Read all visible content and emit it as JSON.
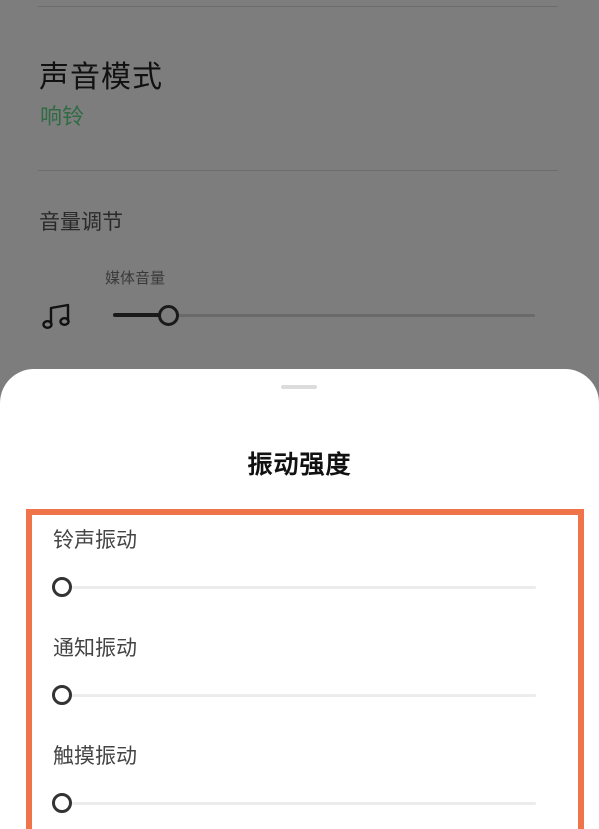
{
  "background": {
    "sound_mode": {
      "title": "声音模式",
      "value": "响铃"
    },
    "volume": {
      "section_title": "音量调节",
      "media": {
        "label": "媒体音量",
        "icon": "music-note-icon",
        "level": 0.13
      }
    }
  },
  "sheet": {
    "title": "振动强度",
    "sliders": [
      {
        "label": "铃声振动",
        "level": 0
      },
      {
        "label": "通知振动",
        "level": 0
      },
      {
        "label": "触摸振动",
        "level": 0
      }
    ]
  },
  "colors": {
    "accent_green": "#2f6b43",
    "highlight_orange": "#f0744a",
    "dim_overlay": "#7d7d7d"
  }
}
